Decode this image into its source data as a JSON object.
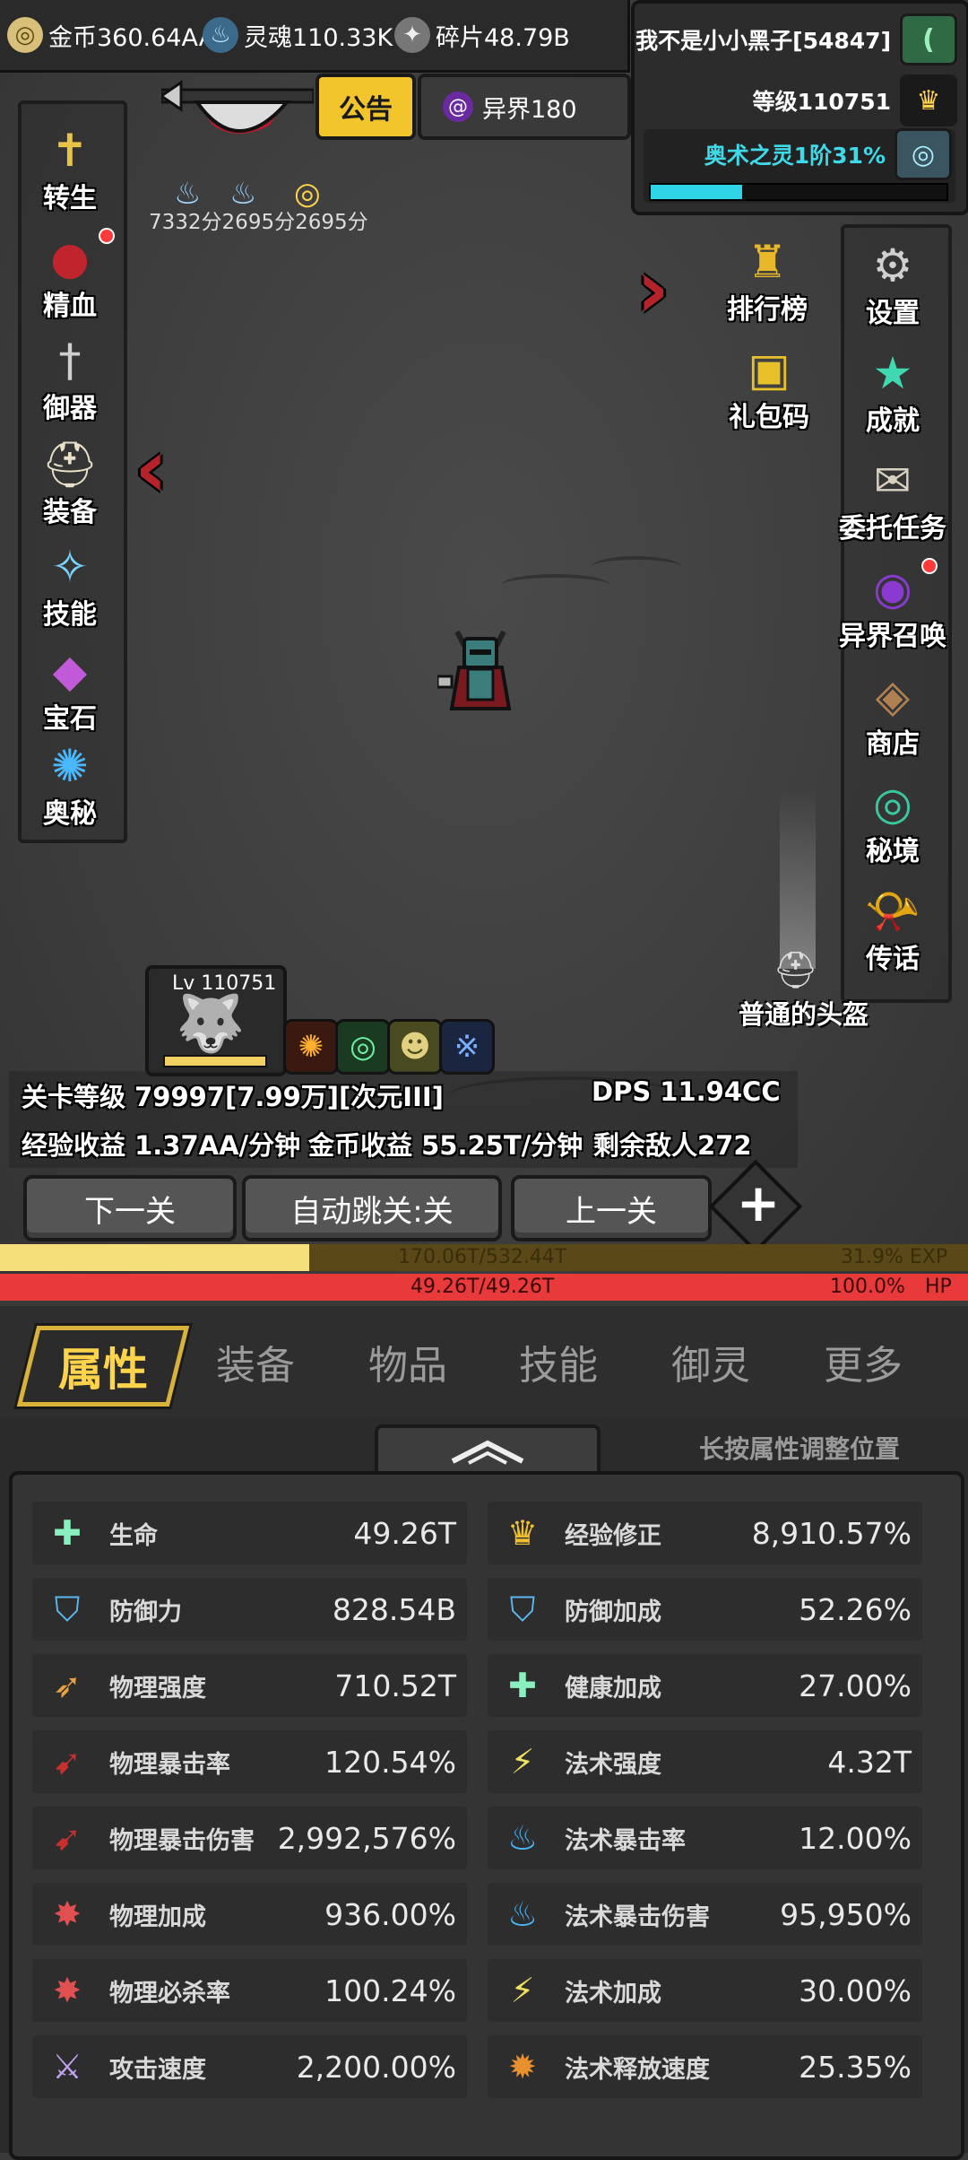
{
  "topbar": {
    "gold": "金币360.64AA",
    "soul": "灵魂110.33K",
    "shard": "碎片48.79B"
  },
  "player": {
    "name": "我不是小小黑子[54847]",
    "level": "等级110751",
    "spirit": "奥术之灵1阶31%",
    "spirit_progress": 0.31
  },
  "announcement": "公告",
  "otherworld": "异界180",
  "buffs": [
    "7332分",
    "2695分",
    "2695分"
  ],
  "left_menu": [
    {
      "label": "转生",
      "icon": "rebirth-icon"
    },
    {
      "label": "精血",
      "icon": "blood-meat-icon"
    },
    {
      "label": "御器",
      "icon": "sword-icon"
    },
    {
      "label": "装备",
      "icon": "helmet-icon"
    },
    {
      "label": "技能",
      "icon": "ice-crystal-icon"
    },
    {
      "label": "宝石",
      "icon": "gem-bag-icon"
    },
    {
      "label": "奥秘",
      "icon": "vortex-icon"
    }
  ],
  "mid_menu": [
    {
      "label": "排行榜",
      "icon": "trophy-icon"
    },
    {
      "label": "礼包码",
      "icon": "gift-chest-icon"
    }
  ],
  "right_menu": [
    {
      "label": "设置",
      "icon": "gear-icon"
    },
    {
      "label": "成就",
      "icon": "star-icon"
    },
    {
      "label": "委托任务",
      "icon": "quest-scroll-icon"
    },
    {
      "label": "异界召唤",
      "icon": "portal-icon"
    },
    {
      "label": "商店",
      "icon": "shop-bag-icon"
    },
    {
      "label": "秘境",
      "icon": "secret-realm-icon"
    },
    {
      "label": "传话",
      "icon": "horn-icon"
    }
  ],
  "drop_item": "普通的头盔",
  "pet": {
    "level": "Lv 110751"
  },
  "stage": {
    "level": "关卡等级 79997[7.99万][次元III]",
    "dps": "DPS 11.94CC",
    "exp_rate": "经验收益 1.37AA/分钟",
    "gold_rate": "金币收益 55.25T/分钟",
    "enemies": "剩余敌人272"
  },
  "buttons": {
    "next": "下一关",
    "auto_skip": "自动跳关:关",
    "prev": "上一关"
  },
  "exp_bar": {
    "text": "170.06T/532.44T",
    "percent": "31.9% EXP",
    "fill": 0.319
  },
  "hp_bar": {
    "text": "49.26T/49.26T",
    "percent": "100.0%",
    "label": "HP",
    "fill": 1.0
  },
  "tabs": [
    "属性",
    "装备",
    "物品",
    "技能",
    "御灵",
    "更多"
  ],
  "hint": "长按属性调整位置",
  "attributes_left": [
    {
      "name": "生命",
      "value": "49.26T",
      "icon": "health-cross-icon"
    },
    {
      "name": "防御力",
      "value": "828.54B",
      "icon": "shield-icon"
    },
    {
      "name": "物理强度",
      "value": "710.52T",
      "icon": "claw-icon"
    },
    {
      "name": "物理暴击率",
      "value": "120.54%",
      "icon": "red-claw-icon"
    },
    {
      "name": "物理暴击伤害",
      "value": "2,992,576%",
      "icon": "red-claw-icon"
    },
    {
      "name": "物理加成",
      "value": "936.00%",
      "icon": "blade-burst-icon"
    },
    {
      "name": "物理必杀率",
      "value": "100.24%",
      "icon": "blade-burst-icon"
    },
    {
      "name": "攻击速度",
      "value": "2,200.00%",
      "icon": "sword-speed-icon"
    }
  ],
  "attributes_right": [
    {
      "name": "经验修正",
      "value": "8,910.57%",
      "icon": "crown-icon"
    },
    {
      "name": "防御加成",
      "value": "52.26%",
      "icon": "shield-icon"
    },
    {
      "name": "健康加成",
      "value": "27.00%",
      "icon": "health-cross-icon"
    },
    {
      "name": "法术强度",
      "value": "4.32T",
      "icon": "lightning-icon"
    },
    {
      "name": "法术暴击率",
      "value": "12.00%",
      "icon": "blue-flame-icon"
    },
    {
      "name": "法术暴击伤害",
      "value": "95,950%",
      "icon": "blue-flame-icon"
    },
    {
      "name": "法术加成",
      "value": "30.00%",
      "icon": "lightning-icon"
    },
    {
      "name": "法术释放速度",
      "value": "25.35%",
      "icon": "fire-hand-icon"
    }
  ],
  "colors": {
    "gold_accent": "#ffd34a",
    "exp_fill": "#f5df7a",
    "hp_fill": "#e83a3a",
    "spirit_text": "#3fd9e8"
  }
}
